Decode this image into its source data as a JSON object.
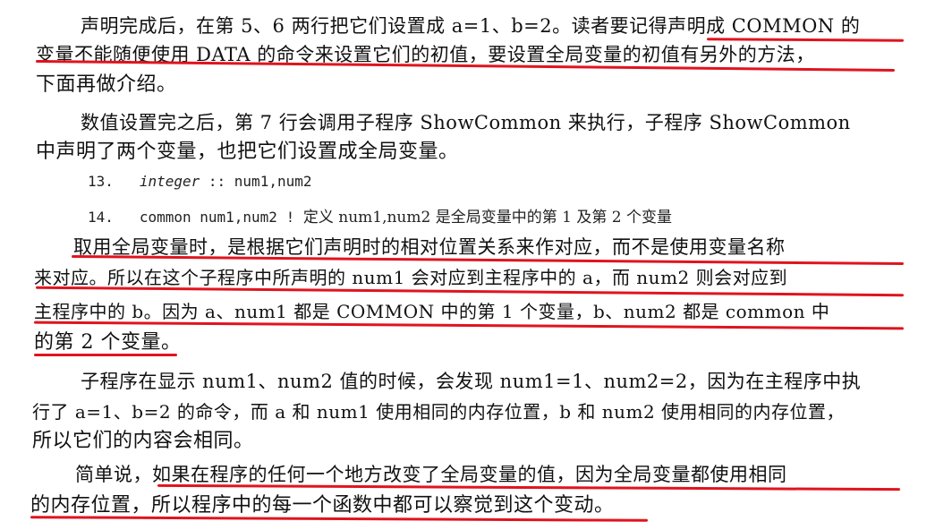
{
  "document": {
    "paragraph1": {
      "line1": "声明完成后，在第 5、6 两行把它们设置成 a=1、b=2。读者要记得声明成 COMMON 的",
      "line2": "变量不能随便使用 DATA 的命令来设置它们的初值，要设置全局变量的初值有另外的方法，",
      "line3": "下面再做介绍。"
    },
    "paragraph2": {
      "line1": "数值设置完之后，第 7 行会调用子程序 ShowCommon 来执行，子程序 ShowCommon",
      "line2": "中声明了两个变量，也把它们设置成全局变量。"
    },
    "code": {
      "line13_num": "13.",
      "line13_kw": "integer",
      "line13_rest": ":: num1,num2",
      "line14_num": "14.",
      "line14_code": "common num1,num2 !",
      "line14_comment": "定义 num1,num2 是全局变量中的第 1 及第 2 个变量"
    },
    "paragraph3": {
      "line1": "取用全局变量时，是根据它们声明时的相对位置关系来作对应，而不是使用变量名称",
      "line2": "来对应。所以在这个子程序中所声明的 num1 会对应到主程序中的 a，而 num2 则会对应到",
      "line3": "主程序中的 b。因为 a、num1 都是 COMMON 中的第 1 个变量，b、num2 都是 common 中",
      "line4": "的第 2 个变量。"
    },
    "paragraph4": {
      "line1": "子程序在显示 num1、num2 值的时候，会发现 num1=1、num2=2，因为在主程序中执",
      "line2": "行了 a=1、b=2 的命令，而 a 和 num1 使用相同的内存位置，b 和 num2 使用相同的内存位置，",
      "line3": "所以它们的内容会相同。"
    },
    "paragraph5": {
      "line1": "简单说，如果在程序的任何一个地方改变了全局变量的值，因为全局变量都使用相同",
      "line2": "的内存位置，所以程序中的每一个函数中都可以察觉到这个变动。"
    },
    "underline_color": "#e0141e"
  }
}
